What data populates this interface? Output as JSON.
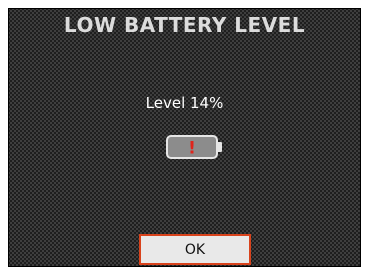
{
  "dialog": {
    "title": "LOW BATTERY LEVEL",
    "level_text": "Level 14%",
    "battery_level_fraction": 0.14,
    "battery_icon": "battery-low-warning-icon",
    "warning_mark": "!",
    "ok_label": "OK"
  },
  "colors": {
    "background": "#1c1c1c",
    "title": "#dcdcdc",
    "warning_mark": "#e0241b",
    "button_border": "#d9431c",
    "button_fill": "#e9e9e9"
  }
}
